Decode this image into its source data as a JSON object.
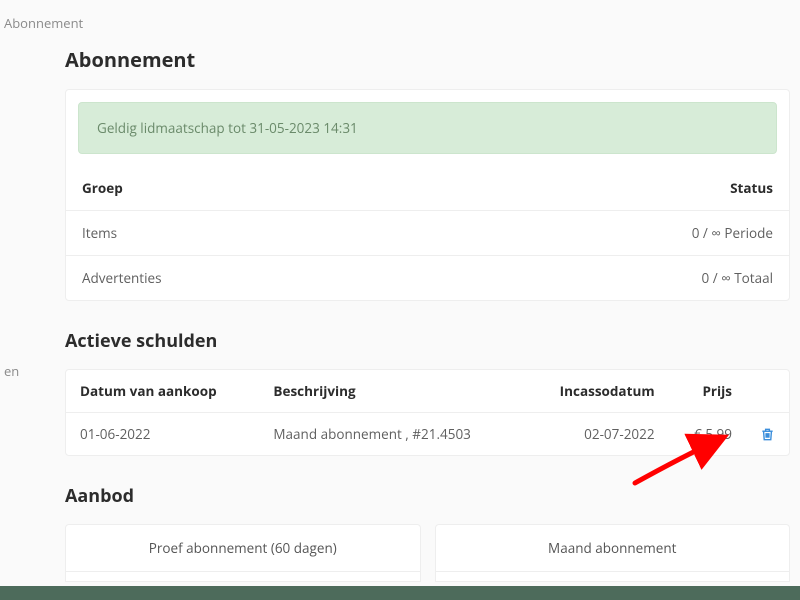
{
  "sidebar": {
    "items": [
      "Abonnement",
      "en"
    ]
  },
  "page": {
    "title": "Abonnement",
    "membership_notice": "Geldig lidmaatschap tot 31-05-2023 14:31",
    "group_table": {
      "headers": {
        "group": "Groep",
        "status": "Status"
      },
      "rows": [
        {
          "group": "Items",
          "status": "0 / ∞ Periode"
        },
        {
          "group": "Advertenties",
          "status": "0 / ∞ Totaal"
        }
      ]
    },
    "debts": {
      "title": "Actieve schulden",
      "headers": {
        "date": "Datum van aankoop",
        "desc": "Beschrijving",
        "incasso": "Incassodatum",
        "price": "Prijs"
      },
      "rows": [
        {
          "date": "01-06-2022",
          "desc": "Maand abonnement , #21.4503",
          "incasso": "02-07-2022",
          "price": "€ 5,99"
        }
      ]
    },
    "offers": {
      "title": "Aanbod",
      "items": [
        "Proef abonnement (60 dagen)",
        "Maand abonnement"
      ]
    }
  }
}
